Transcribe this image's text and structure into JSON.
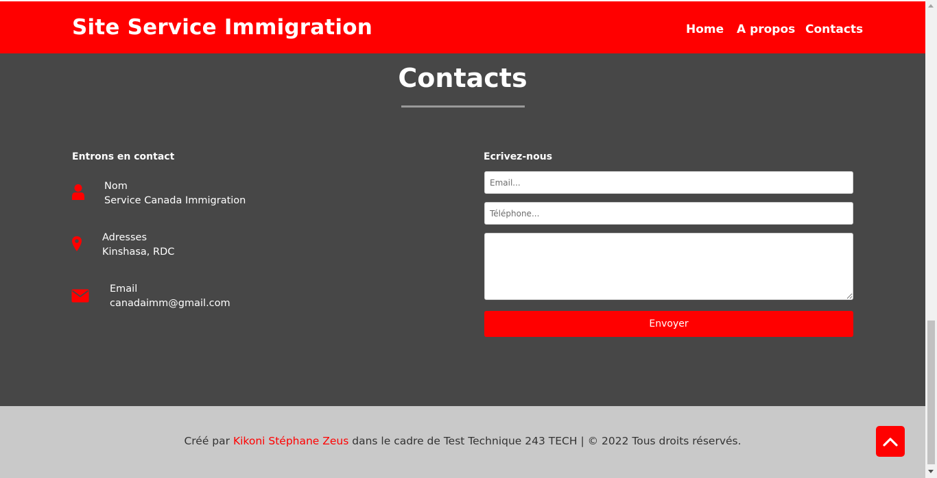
{
  "header": {
    "brand": "Site Service Immigration",
    "nav": [
      {
        "label": "Home"
      },
      {
        "label": "A propos"
      },
      {
        "label": "Contacts"
      }
    ]
  },
  "main": {
    "title": "Contacts",
    "info": {
      "heading": "Entrons en contact",
      "items": [
        {
          "icon": "user-icon",
          "label": "Nom",
          "value": "Service Canada Immigration"
        },
        {
          "icon": "map-marker-icon",
          "label": "Adresses",
          "value": "Kinshasa, RDC"
        },
        {
          "icon": "envelope-icon",
          "label": "Email",
          "value": "canadaimm@gmail.com"
        }
      ]
    },
    "form": {
      "heading": "Ecrivez-nous",
      "email_placeholder": "Email...",
      "phone_placeholder": "Téléphone...",
      "message_value": "",
      "submit_label": "Envoyer"
    }
  },
  "footer": {
    "prefix": "Créé par ",
    "author": "Kikoni Stéphane Zeus",
    "suffix": " dans le cadre de Test Technique 243 TECH | © 2022 Tous droits réservés."
  },
  "colors": {
    "accent": "#ff0000",
    "background": "#474747",
    "footer": "#c9c9c9"
  }
}
